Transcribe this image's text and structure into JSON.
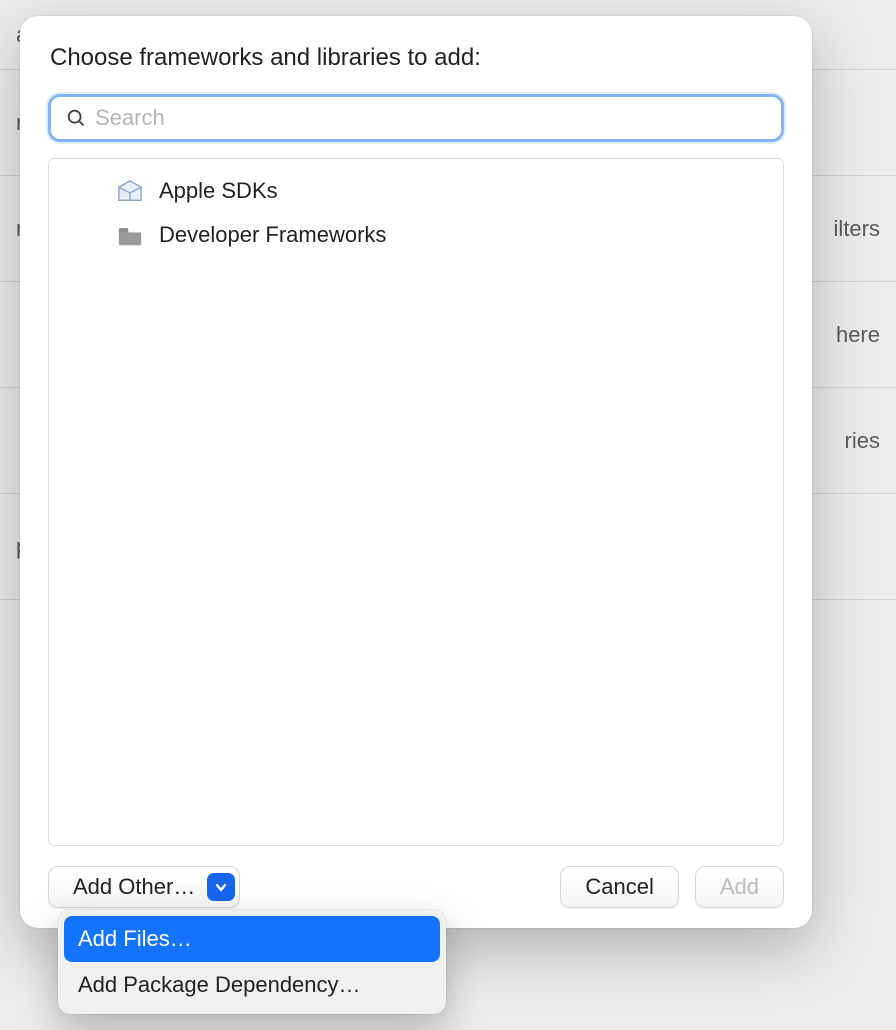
{
  "background": {
    "rows": [
      {
        "left": "a",
        "right": ""
      },
      {
        "left": "n",
        "right": ""
      },
      {
        "left": "n",
        "right": "ilters"
      },
      {
        "left": "",
        "right": "here"
      },
      {
        "left": "",
        "right": "ries"
      },
      {
        "left": "p",
        "right": ""
      }
    ]
  },
  "sheet": {
    "title": "Choose frameworks and libraries to add:",
    "search": {
      "placeholder": "Search",
      "value": ""
    },
    "items": [
      {
        "kind": "sdk",
        "label": "Apple SDKs"
      },
      {
        "kind": "folder",
        "label": "Developer Frameworks"
      }
    ],
    "buttons": {
      "add_other": "Add Other…",
      "cancel": "Cancel",
      "add": "Add"
    },
    "menu": {
      "items": [
        {
          "label": "Add Files…",
          "selected": true
        },
        {
          "label": "Add Package Dependency…",
          "selected": false
        }
      ]
    }
  }
}
